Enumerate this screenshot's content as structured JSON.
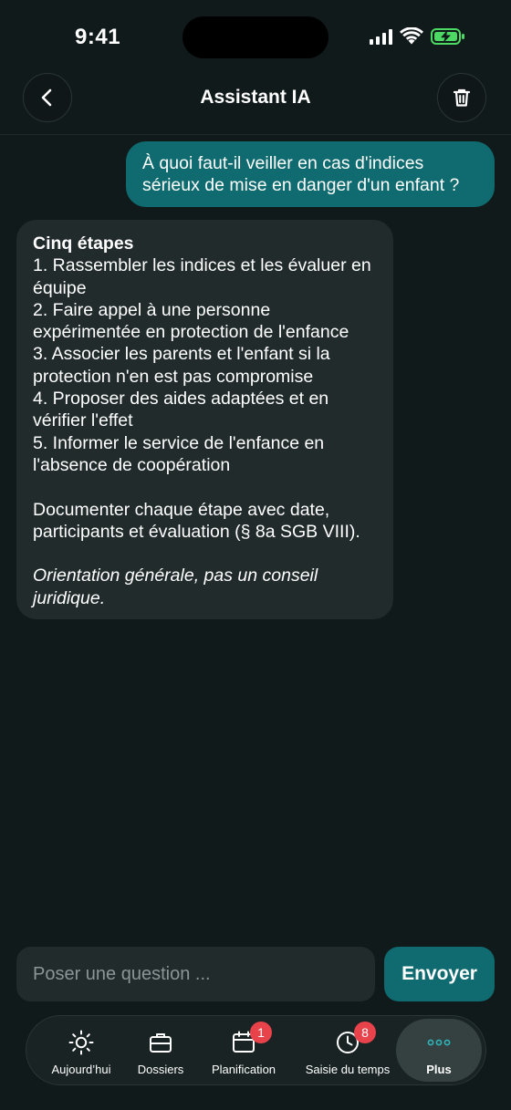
{
  "status_bar": {
    "time": "9:41"
  },
  "header": {
    "title": "Assistant IA"
  },
  "chat": {
    "user_message": "À quoi faut-il veiller en cas d'indices sérieux de mise en danger d'un enfant ?",
    "assistant": {
      "heading": "Cinq étapes",
      "steps": [
        "1. Rassembler les indices et les évaluer en équipe",
        "2. Faire appel à une personne expérimentée en protection de l'enfance",
        "3. Associer les parents et l'enfant si la protection n'en est pas compromise",
        "4. Proposer des aides adaptées et en vérifier l'effet",
        "5. Informer le service de l'enfance en l'absence de coopération"
      ],
      "documentation": "Documenter chaque étape avec date, participants et évaluation (§ 8a SGB VIII).",
      "note": "Orientation générale, pas un conseil juridique."
    }
  },
  "composer": {
    "placeholder": "Poser une question ...",
    "send_label": "Envoyer"
  },
  "tab_bar": {
    "tabs": [
      {
        "label": "Aujourd’hui",
        "icon": "sun-icon"
      },
      {
        "label": "Dossiers",
        "icon": "briefcase-icon"
      },
      {
        "label": "Planification",
        "icon": "calendar-icon",
        "badge": "1"
      },
      {
        "label": "Saisie du temps",
        "icon": "clock-icon",
        "badge": "8"
      },
      {
        "label": "Plus",
        "icon": "more-dots-icon",
        "active": true
      }
    ]
  },
  "colors": {
    "background": "#111a1b",
    "accent": "#0f6b70",
    "bubble": "#212b2c",
    "badge": "#e8424b",
    "battery": "#4cd964"
  }
}
